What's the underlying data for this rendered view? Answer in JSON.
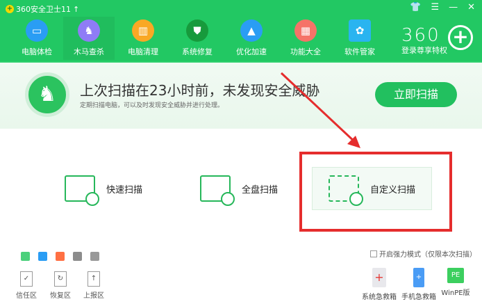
{
  "app": {
    "title": "360安全卫士11",
    "upgrade_icon": "arrow-up-icon"
  },
  "window_controls": [
    "skin-icon",
    "menu-icon",
    "minimize-icon",
    "close-icon"
  ],
  "nav": [
    {
      "label": "电脑体检",
      "color": "#2a9df4",
      "icon": "monitor-icon"
    },
    {
      "label": "木马查杀",
      "color": "#8f7cf6",
      "icon": "horse-icon"
    },
    {
      "label": "电脑清理",
      "color": "#f9a825",
      "icon": "broom-icon"
    },
    {
      "label": "系统修复",
      "color": "#179a3c",
      "icon": "shield-icon"
    },
    {
      "label": "优化加速",
      "color": "#2a9df4",
      "icon": "rocket-icon"
    },
    {
      "label": "功能大全",
      "color": "#f57368",
      "icon": "grid-icon"
    },
    {
      "label": "软件管家",
      "color": "#2ab4f0",
      "icon": "apps-icon"
    }
  ],
  "vip": {
    "brand": "360",
    "label": "登录尊享特权"
  },
  "banner": {
    "title": "上次扫描在23小时前，未发现安全威胁",
    "subtitle": "定期扫描电脑，可以及时发现安全威胁并进行处理。",
    "scan_button": "立即扫描"
  },
  "scan_options": [
    {
      "label": "快速扫描"
    },
    {
      "label": "全盘扫描"
    },
    {
      "label": "自定义扫描"
    }
  ],
  "tools": [
    {
      "color": "#4cd07c"
    },
    {
      "color": "#2a9df4"
    },
    {
      "color": "#ff7043"
    },
    {
      "color": "#8c8c8c"
    },
    {
      "color": "#999999"
    }
  ],
  "zones": [
    {
      "label": "信任区",
      "glyph": "✓"
    },
    {
      "label": "恢复区",
      "glyph": "↻"
    },
    {
      "label": "上报区",
      "glyph": "↑"
    }
  ],
  "strong_mode": "开启强力模式（仅限本次扫描）",
  "rescue": [
    {
      "label": "系统急救箱",
      "glyph": "+",
      "color": "#e8e8ec"
    },
    {
      "label": "手机急救箱",
      "glyph": "+",
      "color": "#4a9cf5"
    },
    {
      "label": "WinPE版",
      "glyph": "PE",
      "color": "#3ccf5f"
    }
  ]
}
